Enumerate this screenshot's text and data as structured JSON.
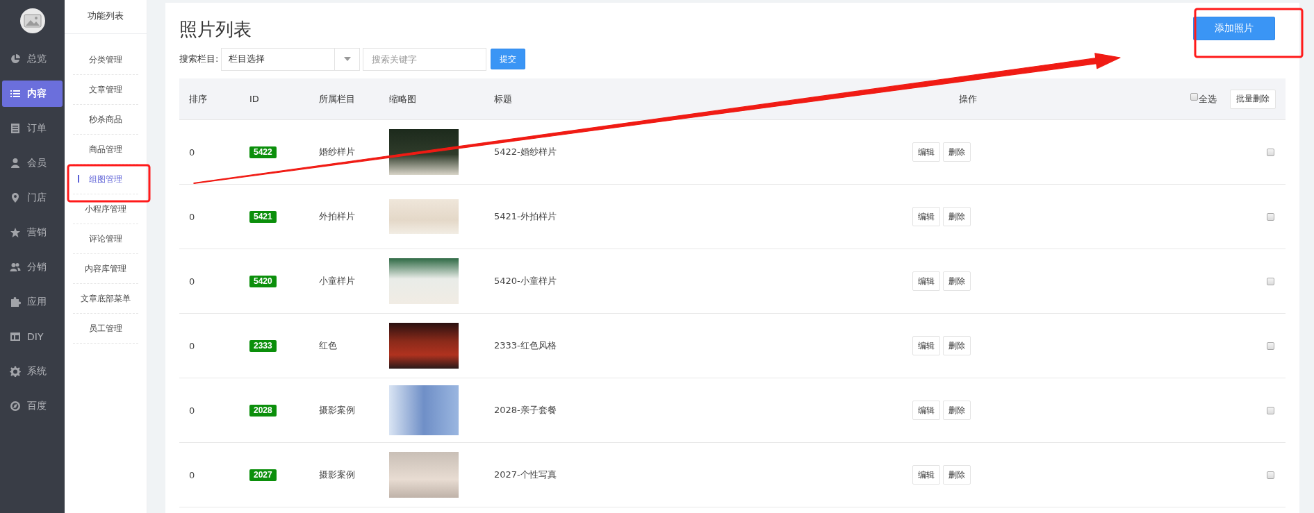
{
  "sidebar": {
    "items": [
      {
        "label": "总览",
        "selected": false
      },
      {
        "label": "内容",
        "selected": true
      },
      {
        "label": "订单",
        "selected": false
      },
      {
        "label": "会员",
        "selected": false
      },
      {
        "label": "门店",
        "selected": false
      },
      {
        "label": "营销",
        "selected": false
      },
      {
        "label": "分销",
        "selected": false
      },
      {
        "label": "应用",
        "selected": false
      },
      {
        "label": "DIY",
        "selected": false
      },
      {
        "label": "系统",
        "selected": false
      },
      {
        "label": "百度",
        "selected": false
      }
    ]
  },
  "submenu": {
    "title": "功能列表",
    "items": [
      {
        "label": "分类管理",
        "selected": false
      },
      {
        "label": "文章管理",
        "selected": false
      },
      {
        "label": "秒杀商品",
        "selected": false
      },
      {
        "label": "商品管理",
        "selected": false
      },
      {
        "label": "组图管理",
        "selected": true
      },
      {
        "label": "小程序管理",
        "selected": false
      },
      {
        "label": "评论管理",
        "selected": false
      },
      {
        "label": "内容库管理",
        "selected": false
      },
      {
        "label": "文章底部菜单",
        "selected": false
      },
      {
        "label": "员工管理",
        "selected": false
      }
    ]
  },
  "page_title": "照片列表",
  "add_button": "添加照片",
  "search": {
    "label": "搜索栏目:",
    "select_value": "栏目选择",
    "placeholder": "搜索关键字",
    "submit": "提交"
  },
  "table": {
    "columns": [
      "排序",
      "ID",
      "所属栏目",
      "缩略图",
      "标题",
      "操作"
    ],
    "select_all": {
      "label": "全选",
      "checked": false
    },
    "batch_delete": "批量删除",
    "rows": [
      {
        "order": "0",
        "id": "5422",
        "category": "婚纱样片",
        "title": "5422-婚纱样片",
        "actions": [
          "编辑",
          "删除"
        ],
        "checked": false
      },
      {
        "order": "0",
        "id": "5421",
        "category": "外拍样片",
        "title": "5421-外拍样片",
        "actions": [
          "编辑",
          "删除"
        ],
        "checked": false
      },
      {
        "order": "0",
        "id": "5420",
        "category": "小童样片",
        "title": "5420-小童样片",
        "actions": [
          "编辑",
          "删除"
        ],
        "checked": false
      },
      {
        "order": "0",
        "id": "2333",
        "category": "红色",
        "title": "2333-红色风格",
        "actions": [
          "编辑",
          "删除"
        ],
        "checked": false
      },
      {
        "order": "0",
        "id": "2028",
        "category": "摄影案例",
        "title": "2028-亲子套餐",
        "actions": [
          "编辑",
          "删除"
        ],
        "checked": false
      },
      {
        "order": "0",
        "id": "2027",
        "category": "摄影案例",
        "title": "2027-个性写真",
        "actions": [
          "编辑",
          "删除"
        ],
        "checked": false
      }
    ]
  }
}
